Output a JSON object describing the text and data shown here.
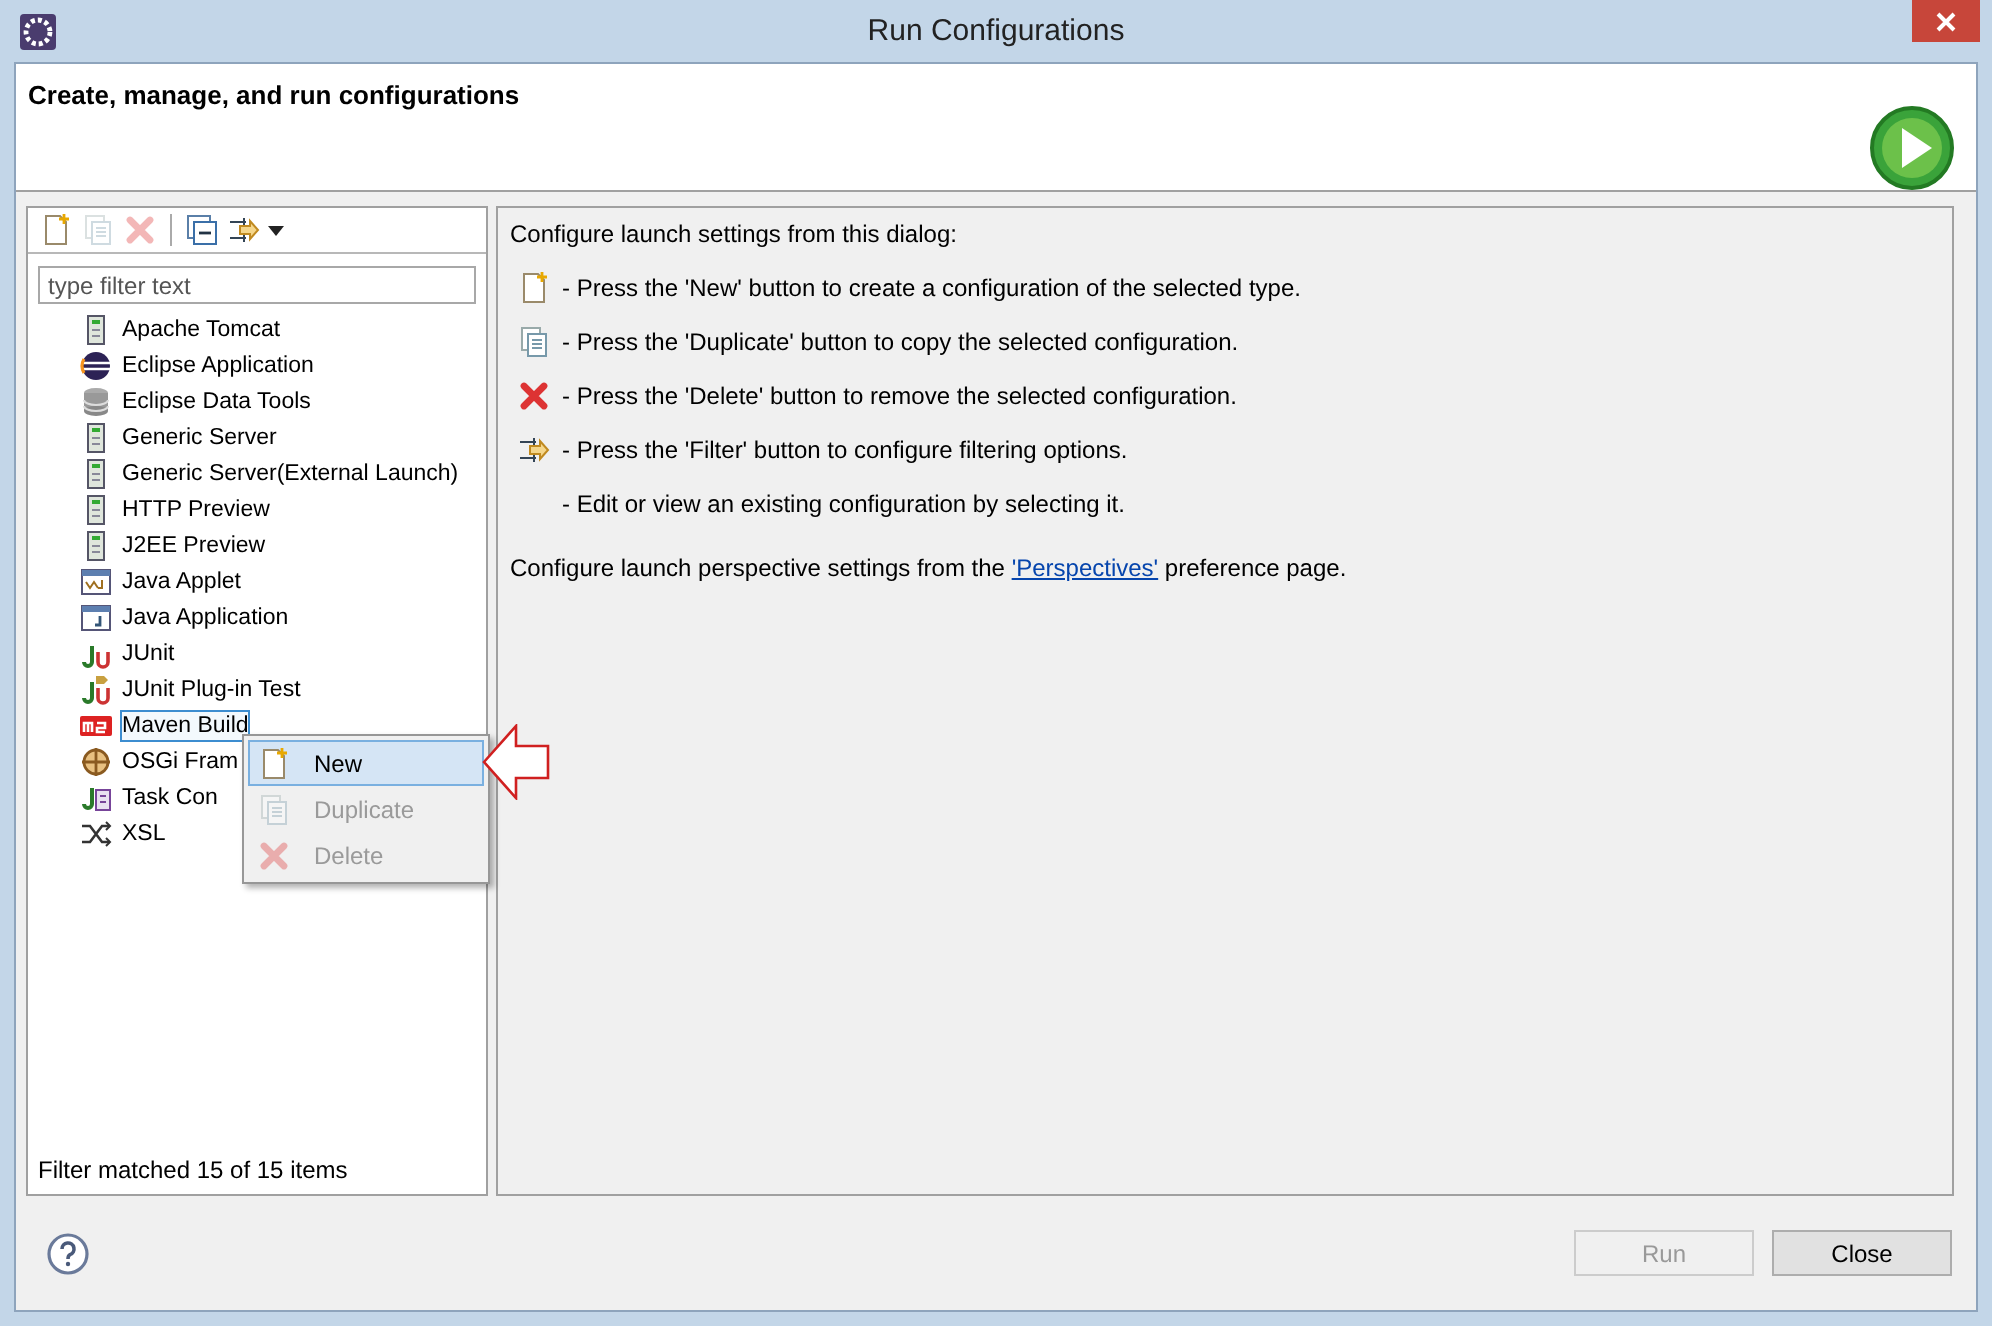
{
  "window": {
    "title": "Run Configurations"
  },
  "header": {
    "title": "Create, manage, and run configurations"
  },
  "toolbar": [
    {
      "kind": "new",
      "disabled": false
    },
    {
      "kind": "duplicate",
      "disabled": true
    },
    {
      "kind": "delete",
      "disabled": true
    },
    {
      "kind": "collapse",
      "disabled": false
    },
    {
      "kind": "filter",
      "disabled": false
    }
  ],
  "filter": {
    "placeholder": "type filter text"
  },
  "tree": [
    {
      "label": "Apache Tomcat",
      "kind": "server",
      "selected": false
    },
    {
      "label": "Eclipse Application",
      "kind": "eclipse",
      "selected": false
    },
    {
      "label": "Eclipse Data Tools",
      "kind": "database",
      "selected": false
    },
    {
      "label": "Generic Server",
      "kind": "server",
      "selected": false
    },
    {
      "label": "Generic Server(External Launch)",
      "kind": "server",
      "selected": false
    },
    {
      "label": "HTTP Preview",
      "kind": "server",
      "selected": false
    },
    {
      "label": "J2EE Preview",
      "kind": "server",
      "selected": false
    },
    {
      "label": "Java Applet",
      "kind": "applet",
      "selected": false
    },
    {
      "label": "Java Application",
      "kind": "javaapp",
      "selected": false
    },
    {
      "label": "JUnit",
      "kind": "junit",
      "selected": false
    },
    {
      "label": "JUnit Plug-in Test",
      "kind": "junitplugin",
      "selected": false
    },
    {
      "label": "Maven Build",
      "kind": "maven",
      "selected": true
    },
    {
      "label": "OSGi Fram",
      "kind": "osgi",
      "selected": false
    },
    {
      "label": "Task Con",
      "kind": "task",
      "selected": false
    },
    {
      "label": "XSL",
      "kind": "xsl",
      "selected": false
    }
  ],
  "status": "Filter matched 15 of 15 items",
  "context_menu": [
    {
      "label": "New",
      "kind": "new",
      "disabled": false,
      "selected": true
    },
    {
      "label": "Duplicate",
      "kind": "duplicate",
      "disabled": true,
      "selected": false
    },
    {
      "label": "Delete",
      "kind": "delete",
      "disabled": true,
      "selected": false
    }
  ],
  "info": {
    "heading": "Configure launch settings from this dialog:",
    "lines": [
      {
        "kind": "new",
        "text": "- Press the 'New' button to create a configuration of the selected type."
      },
      {
        "kind": "duplicate",
        "text": "- Press the 'Duplicate' button to copy the selected configuration."
      },
      {
        "kind": "delete",
        "text": "- Press the 'Delete' button to remove the selected configuration."
      },
      {
        "kind": "filter",
        "text": "- Press the 'Filter' button to configure filtering options."
      },
      {
        "kind": "none",
        "text": "- Edit or view an existing configuration by selecting it."
      }
    ],
    "perspective": {
      "before": "Configure launch perspective settings from the ",
      "link": "'Perspectives'",
      "after": " preference page."
    }
  },
  "buttons": [
    {
      "label": "Run",
      "disabled": true
    },
    {
      "label": "Close",
      "disabled": false
    }
  ]
}
